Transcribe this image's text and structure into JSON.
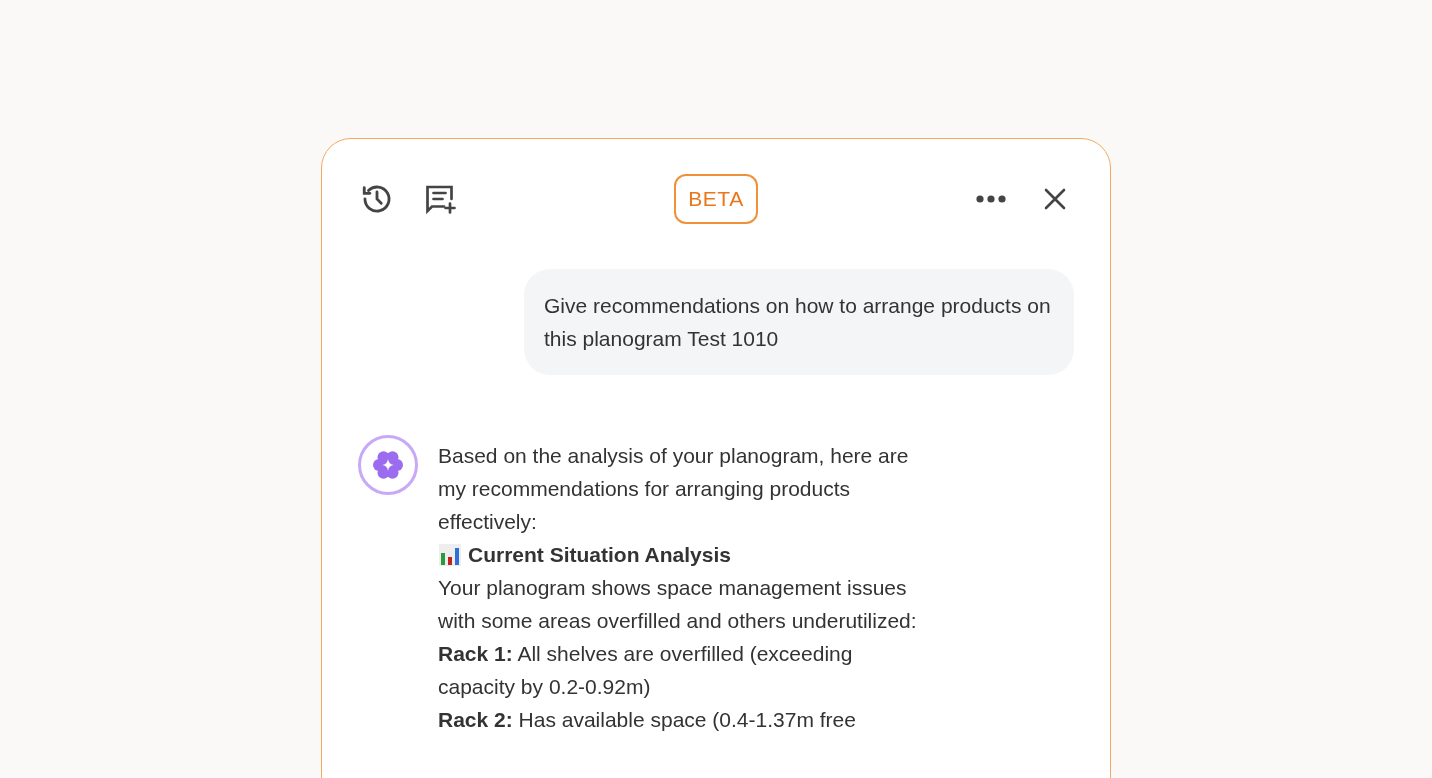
{
  "header": {
    "badge": "BETA"
  },
  "user_message": "Give recommendations on how to arrange products on this planogram Test 1010",
  "assistant_message": [
    {
      "kind": "paragraph",
      "text": "Based on the analysis of your planogram, here are my recommendations for arranging products effectively:"
    },
    {
      "kind": "heading",
      "text": "Current Situation Analysis"
    },
    {
      "kind": "paragraph",
      "text": "Your planogram shows space management issues with some areas overfilled and others underutilized:"
    },
    {
      "kind": "paragraph",
      "text": "**Rack 1:** All shelves are overfilled (exceeding capacity by 0.2-0.92m)"
    },
    {
      "kind": "paragraph",
      "text": "**Rack 2:** Has available space (0.4-1.37m free"
    }
  ]
}
